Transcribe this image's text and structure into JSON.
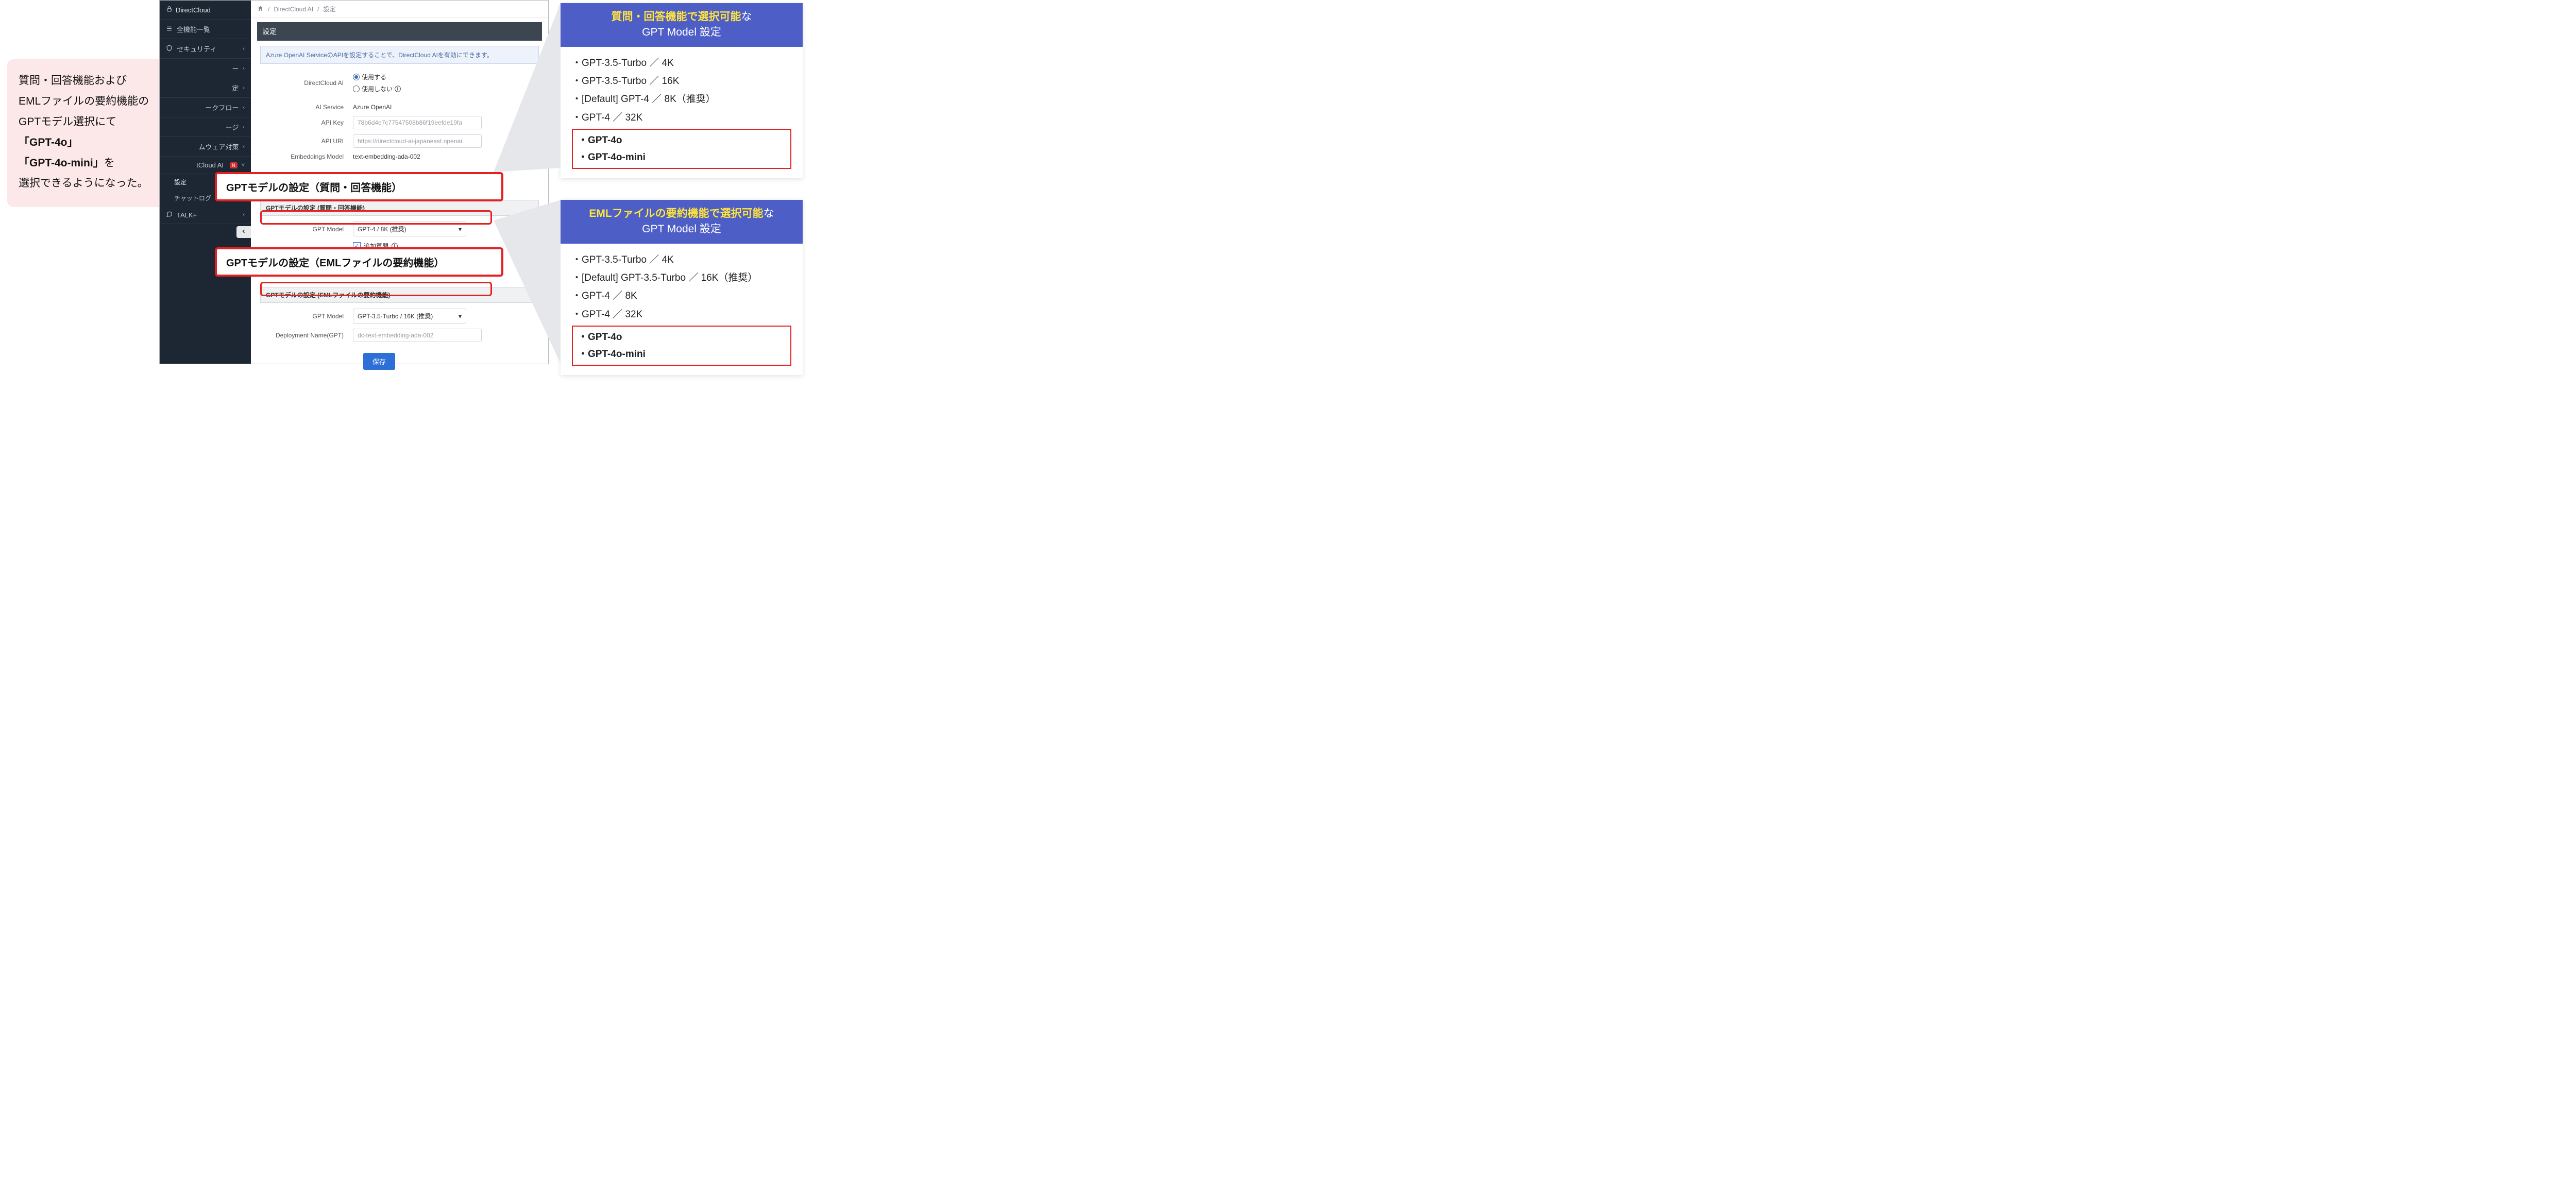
{
  "bubble": {
    "line1": "質問・回答機能および",
    "line2": "EMLファイルの要約機能の",
    "line3": "GPTモデル選択にて",
    "bold1": "「GPT-4o」",
    "bold2a": "「GPT-4o-mini」",
    "tail2": "を",
    "line5": "選択できるようになった。"
  },
  "sidebar": {
    "brand": "DirectCloud",
    "items": {
      "all": "全機能一覧",
      "security": "セキュリティ",
      "partial1": "ー",
      "partial2": "定",
      "partial3": "ークフロー",
      "partial4": "ージ",
      "partial5": "ムウェア対策",
      "aicloud": "tCloud AI",
      "aicloud_new": "N",
      "sub_settings": "設定",
      "sub_chatlog": "チャットログ",
      "talk": "TALK+"
    }
  },
  "crumb": {
    "root": "DirectCloud AI",
    "leaf": "設定"
  },
  "settings": {
    "title": "設定",
    "info": "Azure OpenAI ServiceのAPIを設定することで、DirectCloud AIを有効にできます。",
    "dcai_label": "DirectCloud AI",
    "use_on": "使用する",
    "use_off": "使用しない",
    "ai_service_label": "AI Service",
    "ai_service_value": "Azure OpenAI",
    "api_key_label": "API Key",
    "api_key_value": "78b6d4e7c77547508b86f19eefde19fa",
    "api_uri_label": "API URI",
    "api_uri_value": "https://directcloud-ai-japaneast.openai.",
    "emb_label": "Embeddings Model",
    "emb_value": "text-embedding-ada-002",
    "sec_qa": "GPTモデルの設定 (質問・回答機能)",
    "gpt_label": "GPT Model",
    "gpt_qa_value": "GPT-4 / 8K (推奨)",
    "addq": "追加質問",
    "sec_eml": "GPTモデルの設定 (EMLファイルの要約機能)",
    "gpt_eml_value": "GPT-3.5-Turbo / 16K (推奨)",
    "depname_label": "Deployment Name(GPT)",
    "depname_value": "dc-text-embedding-ada-002",
    "save": "保存"
  },
  "overlay": {
    "qa_big": "GPTモデルの設定（質問・回答機能）",
    "eml_big": "GPTモデルの設定（EMLファイルの要約機能）"
  },
  "panel_qa": {
    "hdr_accent": "質問・回答機能で選択可能",
    "hdr_tail": "な",
    "hdr_line2": "GPT Model 設定",
    "items": [
      "・GPT-3.5-Turbo ／ 4K",
      "・GPT-3.5-Turbo ／ 16K",
      "・[Default] GPT-4 ／ 8K（推奨）",
      "・GPT-4 ／ 32K"
    ],
    "new1": "・GPT-4o",
    "new2": "・GPT-4o-mini"
  },
  "panel_eml": {
    "hdr_accent": "EMLファイルの要約機能で選択可能",
    "hdr_tail": "な",
    "hdr_line2": "GPT Model 設定",
    "items": [
      "・GPT-3.5-Turbo ／ 4K",
      "・[Default] GPT-3.5-Turbo ／ 16K（推奨）",
      "・GPT-4 ／ 8K",
      "・GPT-4 ／ 32K"
    ],
    "new1": "・GPT-4o",
    "new2": "・GPT-4o-mini"
  }
}
